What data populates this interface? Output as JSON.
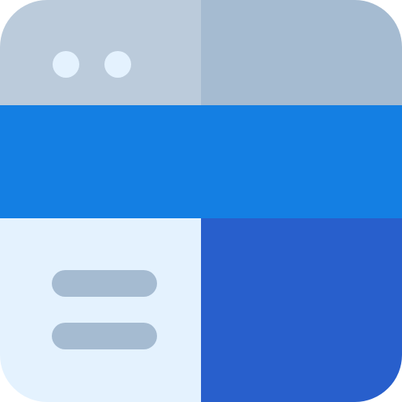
{
  "icon": {
    "name": "browser-window-layout-icon",
    "title_bar_left_color": "#BBCBDB",
    "title_bar_right_color": "#A5BBD1",
    "dot_color": "#E4F2FE",
    "header_band_color": "#147FE3",
    "bottom_left_panel_color": "#E4F2FE",
    "bottom_right_panel_color": "#285FCC",
    "menu_line_color": "#A5BBD1",
    "window_control_count": 2,
    "menu_line_count": 2
  }
}
